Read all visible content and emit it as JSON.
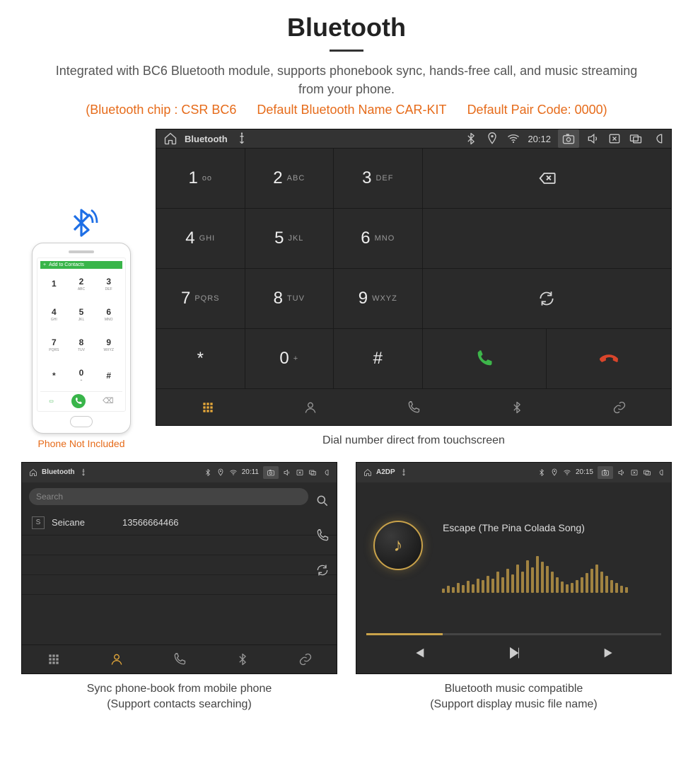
{
  "title": "Bluetooth",
  "subtitle": "Integrated with BC6 Bluetooth module, supports phonebook sync, hands-free call, and music streaming from your phone.",
  "chip_info": {
    "chip": "(Bluetooth chip : CSR BC6",
    "name": "Default Bluetooth Name CAR-KIT",
    "code": "Default Pair Code: 0000)"
  },
  "phone": {
    "add_contacts": "Add to Contacts",
    "keys": [
      {
        "n": "1",
        "s": ""
      },
      {
        "n": "2",
        "s": "ABC"
      },
      {
        "n": "3",
        "s": "DEF"
      },
      {
        "n": "4",
        "s": "GHI"
      },
      {
        "n": "5",
        "s": "JKL"
      },
      {
        "n": "6",
        "s": "MNO"
      },
      {
        "n": "7",
        "s": "PQRS"
      },
      {
        "n": "8",
        "s": "TUV"
      },
      {
        "n": "9",
        "s": "WXYZ"
      },
      {
        "n": "*",
        "s": ""
      },
      {
        "n": "0",
        "s": "+"
      },
      {
        "n": "#",
        "s": ""
      }
    ],
    "caption": "Phone Not Included"
  },
  "hu_main": {
    "app_title": "Bluetooth",
    "time": "20:12",
    "keypad": [
      {
        "n": "1",
        "s": "oo"
      },
      {
        "n": "2",
        "s": "ABC"
      },
      {
        "n": "3",
        "s": "DEF"
      },
      {
        "n": "4",
        "s": "GHI"
      },
      {
        "n": "5",
        "s": "JKL"
      },
      {
        "n": "6",
        "s": "MNO"
      },
      {
        "n": "7",
        "s": "PQRS"
      },
      {
        "n": "8",
        "s": "TUV"
      },
      {
        "n": "9",
        "s": "WXYZ"
      },
      {
        "n": "*",
        "s": ""
      },
      {
        "n": "0",
        "s": "+"
      },
      {
        "n": "#",
        "s": ""
      }
    ],
    "caption": "Dial number direct from touchscreen"
  },
  "hu_contacts": {
    "app_title": "Bluetooth",
    "time": "20:11",
    "search_placeholder": "Search",
    "contact_badge": "S",
    "contact_name": "Seicane",
    "contact_number": "13566664466",
    "caption_line1": "Sync phone-book from mobile phone",
    "caption_line2": "(Support contacts searching)"
  },
  "hu_music": {
    "app_title": "A2DP",
    "time": "20:15",
    "track": "Escape (The Pina Colada Song)",
    "eq_bars": [
      6,
      10,
      8,
      14,
      11,
      17,
      12,
      20,
      18,
      24,
      20,
      30,
      22,
      34,
      26,
      40,
      30,
      46,
      36,
      52,
      44,
      38,
      30,
      22,
      16,
      12,
      14,
      18,
      22,
      28,
      34,
      40,
      30,
      24,
      18,
      14,
      10,
      8
    ],
    "caption_line1": "Bluetooth music compatible",
    "caption_line2": "(Support display music file name)"
  }
}
